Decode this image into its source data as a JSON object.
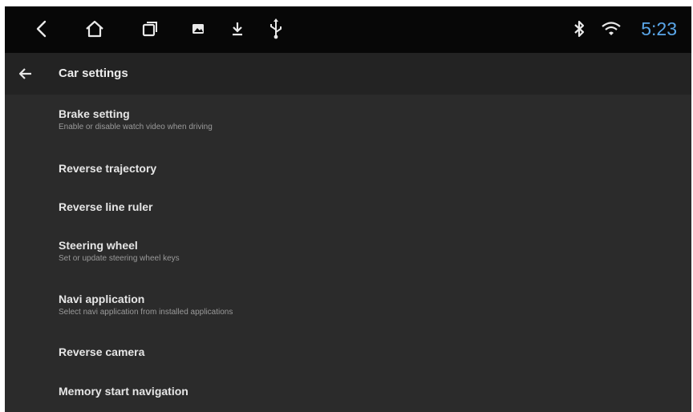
{
  "status_bar": {
    "nav_icons": [
      "back-chevron-icon",
      "home-icon",
      "recent-apps-icon",
      "image-icon",
      "download-icon",
      "usb-icon"
    ],
    "status_icons": [
      "bluetooth-icon",
      "wifi-icon"
    ],
    "time": "5:23",
    "time_color": "#5aa6e8"
  },
  "toolbar": {
    "back_icon": "arrow-left-icon",
    "title": "Car settings"
  },
  "settings": {
    "items": [
      {
        "title": "Brake setting",
        "subtitle": "Enable or disable watch video when driving"
      },
      {
        "title": "Reverse trajectory",
        "subtitle": ""
      },
      {
        "title": "Reverse line ruler",
        "subtitle": ""
      },
      {
        "title": "Steering wheel",
        "subtitle": "Set or update steering wheel keys"
      },
      {
        "title": "Navi application",
        "subtitle": "Select navi application from installed applications"
      },
      {
        "title": "Reverse camera",
        "subtitle": ""
      },
      {
        "title": "Memory start navigation",
        "subtitle": ""
      }
    ]
  }
}
